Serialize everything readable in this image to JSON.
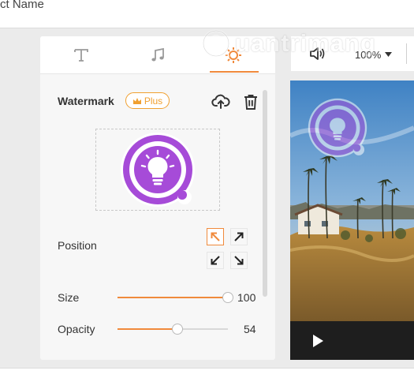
{
  "header": {
    "project_name": "ct Name"
  },
  "tabs": [
    {
      "id": "text",
      "icon": "text-icon"
    },
    {
      "id": "music",
      "icon": "music-note-icon"
    },
    {
      "id": "watermark",
      "icon": "sun-gear-icon",
      "active": true
    }
  ],
  "watermark": {
    "title": "Watermark",
    "plus_badge": "Plus",
    "position_label": "Position",
    "position_selected": "top-left",
    "size_label": "Size",
    "size_value": "100",
    "size_fraction": 1.0,
    "opacity_label": "Opacity",
    "opacity_value": "54",
    "opacity_fraction": 0.54
  },
  "preview": {
    "zoom": "100%",
    "icons": [
      "volume-icon",
      "chevron-down-icon",
      "play-icon"
    ]
  },
  "site_watermark": {
    "text": "uantrimang"
  },
  "colors": {
    "accent": "#f08a3c",
    "badge": "#f0a030",
    "logo_purple": "#a64bd8"
  }
}
